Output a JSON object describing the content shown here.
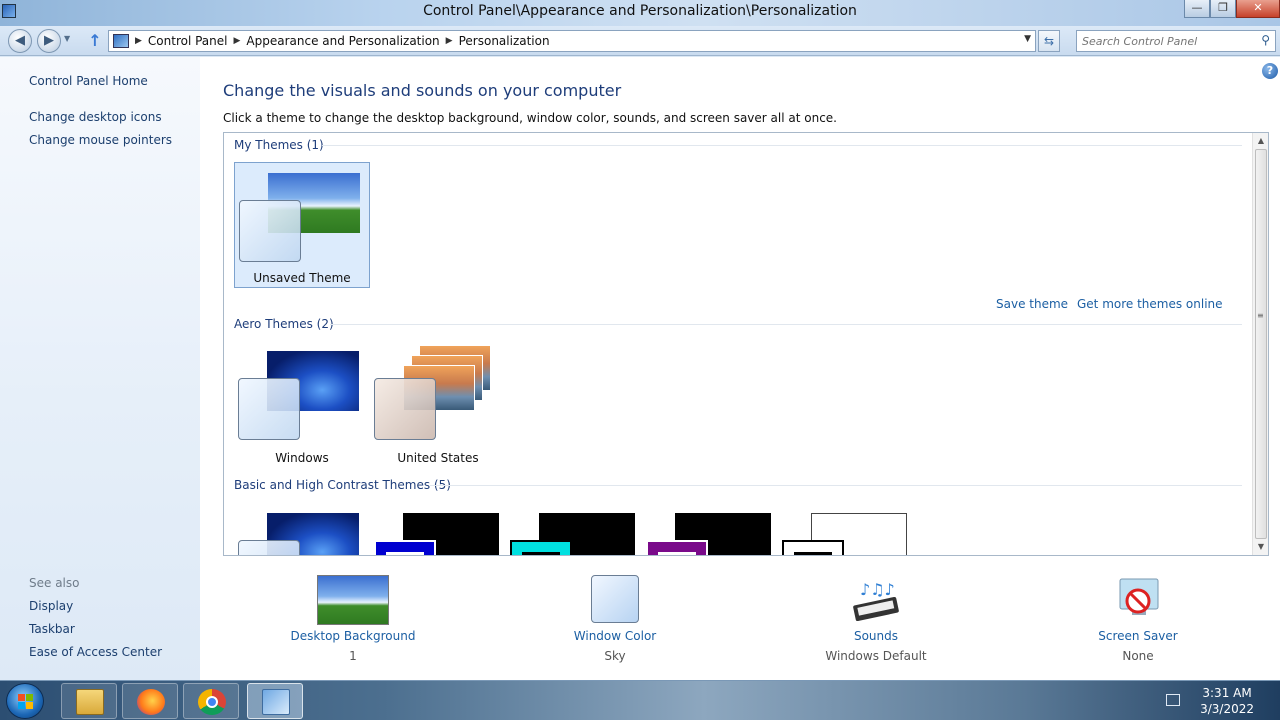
{
  "window": {
    "title": "Control Panel\\Appearance and Personalization\\Personalization",
    "buttons": {
      "minimize": "—",
      "maximize": "❐",
      "close": "✕"
    }
  },
  "navbar": {
    "breadcrumbs": [
      "Control Panel",
      "Appearance and Personalization",
      "Personalization"
    ],
    "search_placeholder": "Search Control Panel"
  },
  "leftpane": {
    "home": "Control Panel Home",
    "links": [
      "Change desktop icons",
      "Change mouse pointers"
    ],
    "see_also_label": "See also",
    "see_also": [
      "Display",
      "Taskbar",
      "Ease of Access Center"
    ]
  },
  "main": {
    "heading": "Change the visuals and sounds on your computer",
    "subheading": "Click a theme to change the desktop background, window color, sounds, and screen saver all at once.",
    "groups": {
      "my": {
        "label": "My Themes (1)",
        "themes": [
          {
            "label": "Unsaved Theme",
            "selected": true
          }
        ]
      },
      "actions": {
        "save": "Save theme",
        "more": "Get more themes online"
      },
      "aero": {
        "label": "Aero Themes (2)",
        "themes": [
          {
            "label": "Windows"
          },
          {
            "label": "United States"
          }
        ]
      },
      "basic": {
        "label": "Basic and High Contrast Themes (5)",
        "count": 5
      }
    }
  },
  "bottom": [
    {
      "name": "Desktop Background",
      "value": "1",
      "icon": "desktop-background-icon"
    },
    {
      "name": "Window Color",
      "value": "Sky",
      "icon": "window-color-icon"
    },
    {
      "name": "Sounds",
      "value": "Windows Default",
      "icon": "sounds-icon"
    },
    {
      "name": "Screen Saver",
      "value": "None",
      "icon": "screen-saver-icon"
    }
  ],
  "taskbar": {
    "clock_time": "3:31 AM",
    "clock_date": "3/3/2022",
    "apps": [
      "file-explorer-icon",
      "firefox-icon",
      "chrome-icon",
      "control-panel-icon"
    ]
  },
  "colors": {
    "link": "#1c5fa3",
    "heading": "#1e3d7a",
    "selected_bg": "#dcebfc"
  }
}
